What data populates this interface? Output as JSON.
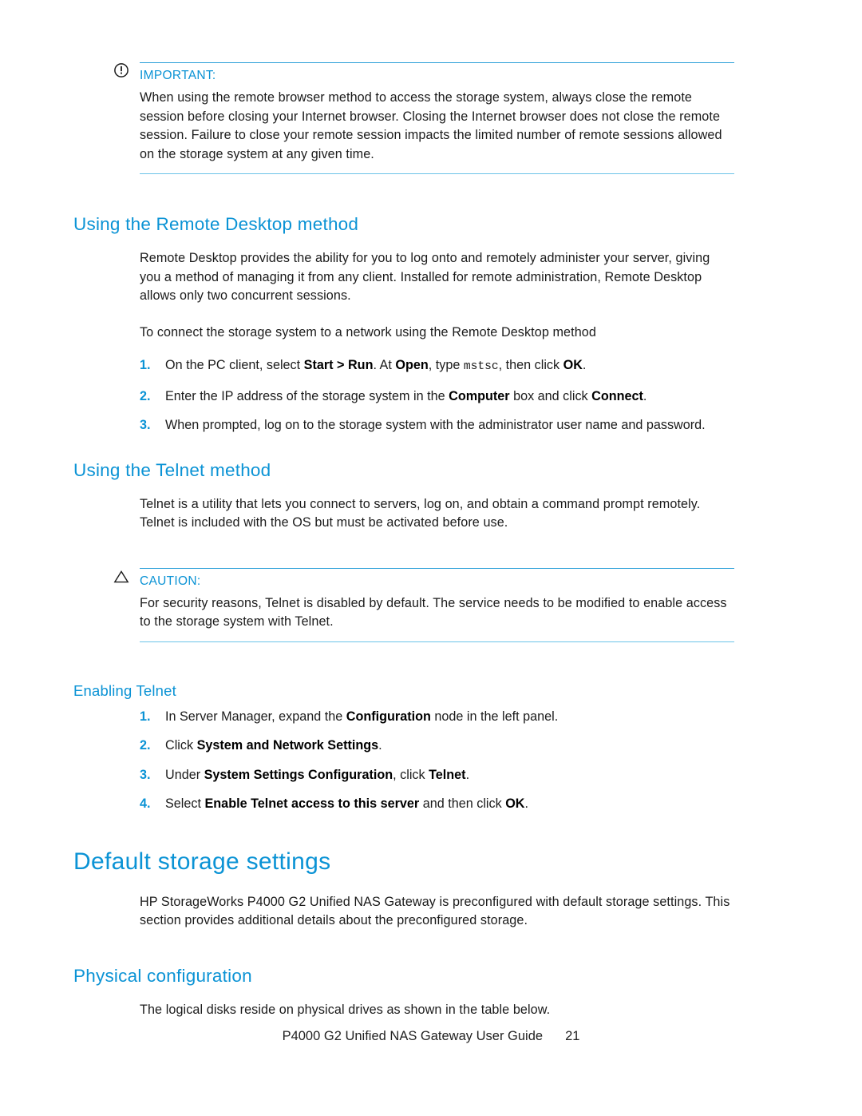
{
  "page": {
    "number": "21",
    "accent_color": "#0b93d5",
    "rule_color_top": "#2a9fd8",
    "rule_color_bottom": "#6cc3e8"
  },
  "important_note": {
    "icon": "exclamation-circle-icon",
    "label": "IMPORTANT:",
    "text": "When using the remote browser method to access the storage system, always close the remote session before closing your Internet browser. Closing the Internet browser does not close the remote session. Failure to close your remote session impacts the limited number of remote sessions allowed on the storage system at any given time."
  },
  "remote_desktop_section": {
    "heading": "Using the Remote Desktop method",
    "intro": "Remote Desktop provides the ability for you to log onto and remotely administer your server, giving you a method of managing it from any client. Installed for remote administration, Remote Desktop allows only two concurrent sessions.",
    "lead_in": "To connect the storage system to a network using the Remote Desktop method",
    "steps": [
      {
        "num": "1.",
        "parts": [
          {
            "t": "On the PC client, select ",
            "s": "plain"
          },
          {
            "t": "Start > Run",
            "s": "bold"
          },
          {
            "t": ". At ",
            "s": "plain"
          },
          {
            "t": "Open",
            "s": "bold"
          },
          {
            "t": ", type ",
            "s": "plain"
          },
          {
            "t": "mstsc",
            "s": "mono"
          },
          {
            "t": ", then click ",
            "s": "plain"
          },
          {
            "t": "OK",
            "s": "bold"
          },
          {
            "t": ".",
            "s": "plain"
          }
        ]
      },
      {
        "num": "2.",
        "parts": [
          {
            "t": "Enter the IP address of the storage system in the ",
            "s": "plain"
          },
          {
            "t": "Computer",
            "s": "bold"
          },
          {
            "t": " box and click ",
            "s": "plain"
          },
          {
            "t": "Connect",
            "s": "bold"
          },
          {
            "t": ".",
            "s": "plain"
          }
        ]
      },
      {
        "num": "3.",
        "parts": [
          {
            "t": "When prompted, log on to the storage system with the administrator user name and password.",
            "s": "plain"
          }
        ]
      }
    ]
  },
  "telnet_section": {
    "heading": "Using the Telnet method",
    "intro": "Telnet is a utility that lets you connect to servers, log on, and obtain a command prompt remotely. Telnet is included with the OS but must be activated before use.",
    "caution": {
      "icon": "warning-triangle-icon",
      "label": "CAUTION:",
      "text": "For security reasons, Telnet is disabled by default. The service needs to be modified to enable access to the storage system with Telnet."
    },
    "enabling": {
      "heading": "Enabling Telnet",
      "steps": [
        {
          "num": "1.",
          "parts": [
            {
              "t": "In Server Manager, expand the ",
              "s": "plain"
            },
            {
              "t": "Configuration",
              "s": "bold"
            },
            {
              "t": " node in the left panel.",
              "s": "plain"
            }
          ]
        },
        {
          "num": "2.",
          "parts": [
            {
              "t": "Click ",
              "s": "plain"
            },
            {
              "t": "System and Network Settings",
              "s": "bold"
            },
            {
              "t": ".",
              "s": "plain"
            }
          ]
        },
        {
          "num": "3.",
          "parts": [
            {
              "t": "Under ",
              "s": "plain"
            },
            {
              "t": "System Settings Configuration",
              "s": "bold"
            },
            {
              "t": ", click ",
              "s": "plain"
            },
            {
              "t": "Telnet",
              "s": "bold"
            },
            {
              "t": ".",
              "s": "plain"
            }
          ]
        },
        {
          "num": "4.",
          "parts": [
            {
              "t": "Select ",
              "s": "plain"
            },
            {
              "t": "Enable Telnet access to this server",
              "s": "bold"
            },
            {
              "t": " and then click ",
              "s": "plain"
            },
            {
              "t": "OK",
              "s": "bold"
            },
            {
              "t": ".",
              "s": "plain"
            }
          ]
        }
      ]
    }
  },
  "default_storage_section": {
    "heading": "Default storage settings",
    "intro": "HP StorageWorks P4000 G2 Unified NAS Gateway is preconfigured with default storage settings. This section provides additional details about the preconfigured storage.",
    "physical_configuration": {
      "heading": "Physical configuration",
      "text": "The logical disks reside on physical drives as shown in the table below."
    }
  },
  "footer": {
    "guide_title": "P4000 G2 Unified NAS Gateway User Guide",
    "page_number": "21"
  }
}
